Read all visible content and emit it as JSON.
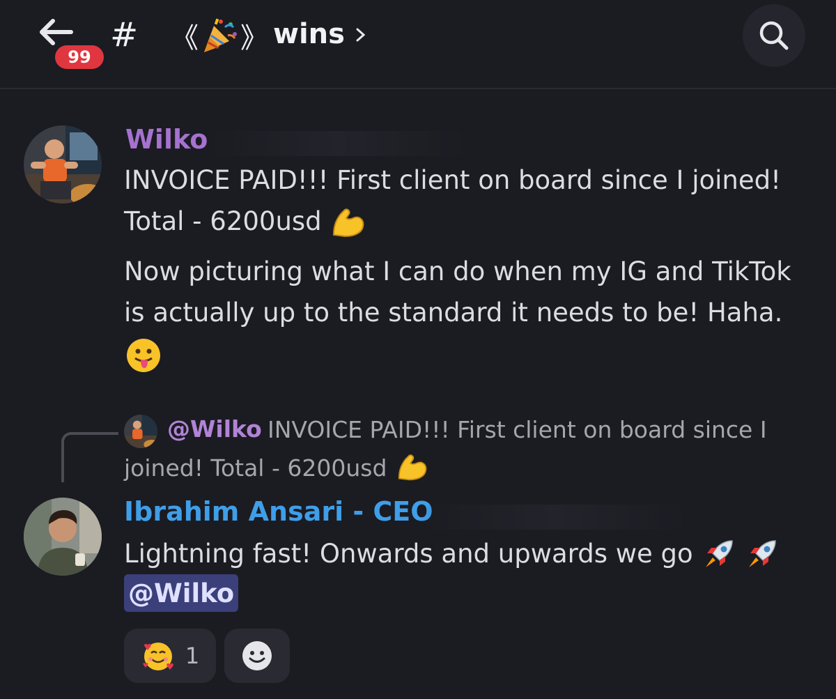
{
  "header": {
    "unread_badge": "99",
    "hash_symbol": "#",
    "channel_name": "wins",
    "back_icon": "arrow-left-icon",
    "search_icon": "search-icon"
  },
  "messages": [
    {
      "author": "Wilko",
      "author_color": "#a572cf",
      "lines": [
        "INVOICE PAID!!!  First client on board since I joined!",
        "Total - 6200usd",
        "Now picturing what I can do when my IG and TikTok",
        "is actually up to the standard it needs to be! Haha."
      ],
      "emojis": [
        "flexed-biceps-icon",
        "tongue-face-icon"
      ]
    },
    {
      "author": "Ibrahim Ansari - CEO",
      "author_color": "#3f9ee8",
      "reply": {
        "mention": "@Wilko",
        "text_line1": "INVOICE PAID!!!  First client on board since I",
        "text_line2": "joined! Total - 6200usd"
      },
      "lines": [
        "Lightning fast! Onwards and upwards we go"
      ],
      "mention": "@Wilko",
      "emojis": [
        "rocket-icon",
        "rocket-icon"
      ]
    }
  ],
  "reactions": [
    {
      "emoji": "smiling-face-with-hearts-icon",
      "count": "1"
    },
    {
      "emoji": "add-reaction-icon",
      "count": ""
    }
  ]
}
